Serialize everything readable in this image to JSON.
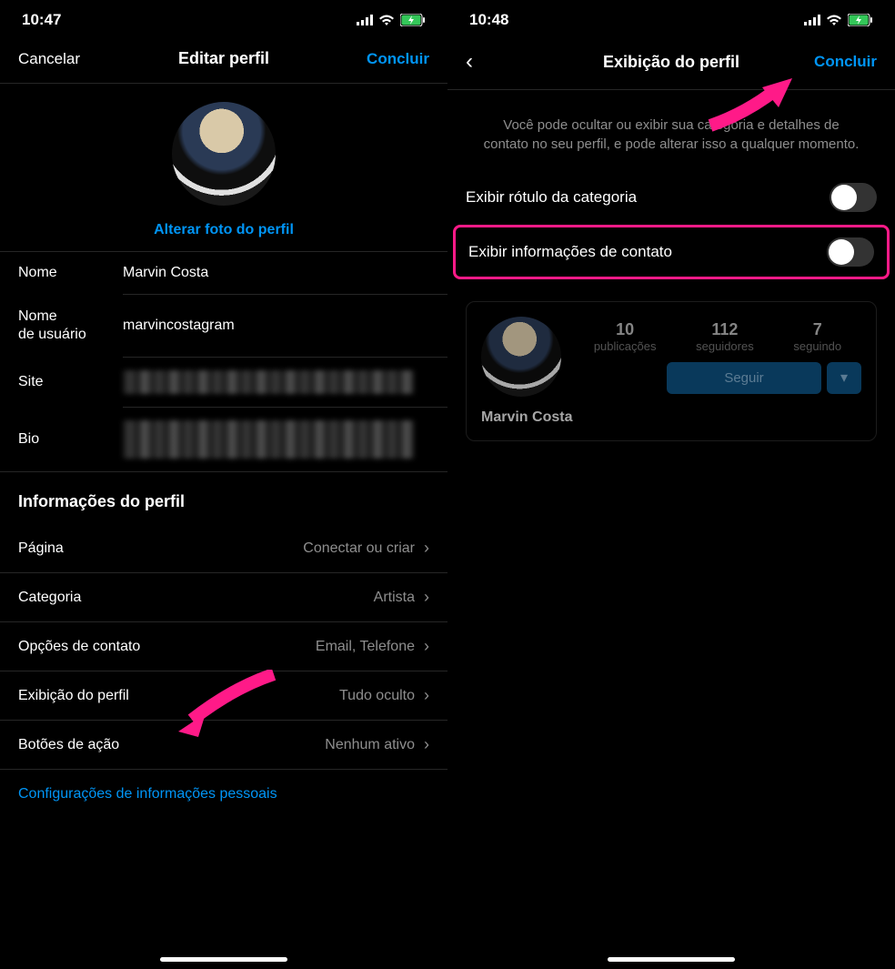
{
  "left": {
    "status_time": "10:47",
    "nav": {
      "cancel": "Cancelar",
      "title": "Editar perfil",
      "done": "Concluir"
    },
    "change_photo": "Alterar foto do perfil",
    "fields": {
      "name_label": "Nome",
      "name_value": "Marvin Costa",
      "username_label": "Nome\nde usuário",
      "username_value": "marvincostagram",
      "site_label": "Site",
      "bio_label": "Bio"
    },
    "section_title": "Informações do perfil",
    "rows": {
      "page_label": "Página",
      "page_value": "Conectar ou criar",
      "category_label": "Categoria",
      "category_value": "Artista",
      "contact_label": "Opções de contato",
      "contact_value": "Email, Telefone",
      "display_label": "Exibição do perfil",
      "display_value": "Tudo oculto",
      "action_label": "Botões de ação",
      "action_value": "Nenhum ativo"
    },
    "personal_link": "Configurações de informações pessoais"
  },
  "right": {
    "status_time": "10:48",
    "nav": {
      "title": "Exibição do perfil",
      "done": "Concluir"
    },
    "description": "Você pode ocultar ou exibir sua categoria e detalhes de contato no seu perfil, e pode alterar isso a qualquer momento.",
    "toggle1_label": "Exibir rótulo da categoria",
    "toggle2_label": "Exibir informações de contato",
    "preview": {
      "stats": {
        "posts_num": "10",
        "posts_label": "publicações",
        "followers_num": "112",
        "followers_label": "seguidores",
        "following_num": "7",
        "following_label": "seguindo"
      },
      "follow_btn": "Seguir",
      "name": "Marvin Costa"
    }
  }
}
